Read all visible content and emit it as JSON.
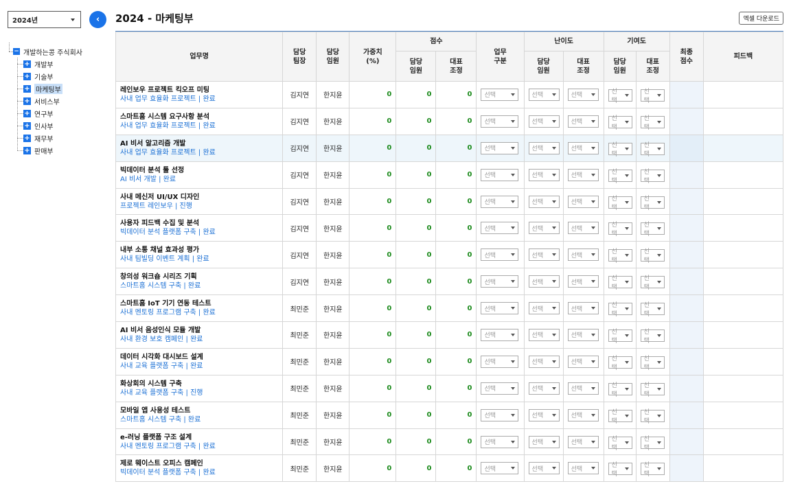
{
  "sidebar": {
    "year": "2024년",
    "collapse_icon": "chevron-left-icon",
    "tree": {
      "root": "개발하는콩 주식회사",
      "children": [
        "개발부",
        "기술부",
        "마케팅부",
        "서비스부",
        "연구부",
        "인사부",
        "재무부",
        "판매부"
      ],
      "selected": "마케팅부"
    }
  },
  "header": {
    "title": "2024 - 마케팅부",
    "excel_button": "엑셀 다운로드"
  },
  "table": {
    "columns": {
      "task": "업무명",
      "team_lead": "담당\n팀장",
      "exec": "담당\n임원",
      "weight": "가중치\n(%)",
      "score": "점수",
      "score_exec": "담당\n임원",
      "score_rep": "대표\n조정",
      "work_type": "업무\n구분",
      "difficulty": "난이도",
      "diff_exec": "담당\n임원",
      "diff_rep": "대표\n조정",
      "contribution": "기여도",
      "contrib_exec": "담당\n임원",
      "contrib_rep": "대표\n조정",
      "final_score": "최종\n점수",
      "feedback": "피드백"
    },
    "select_placeholder": "선택",
    "rows": [
      {
        "name": "레인보우 프로젝트 킥오프 미팅",
        "sub": "사내 업무 효율화 프로젝트 | 완료",
        "lead": "김지연",
        "exec": "한지윤",
        "weight": "0",
        "score_exec": "0",
        "score_rep": "0"
      },
      {
        "name": "스마트홈 시스템 요구사항 분석",
        "sub": "사내 업무 효율화 프로젝트 | 완료",
        "lead": "김지연",
        "exec": "한지윤",
        "weight": "0",
        "score_exec": "0",
        "score_rep": "0"
      },
      {
        "name": "AI 비서 알고리즘 개발",
        "sub": "사내 업무 효율화 프로젝트 | 완료",
        "lead": "김지연",
        "exec": "한지윤",
        "weight": "0",
        "score_exec": "0",
        "score_rep": "0"
      },
      {
        "name": "빅데이터 분석 툴 선정",
        "sub": "AI 비서 개발 | 완료",
        "lead": "김지연",
        "exec": "한지윤",
        "weight": "0",
        "score_exec": "0",
        "score_rep": "0"
      },
      {
        "name": "사내 메신저 UI/UX 디자인",
        "sub": "프로젝트 레인보우 | 진행",
        "lead": "김지연",
        "exec": "한지윤",
        "weight": "0",
        "score_exec": "0",
        "score_rep": "0"
      },
      {
        "name": "사용자 피드백 수집 및 분석",
        "sub": "빅데이터 분석 플랫폼 구축 | 완료",
        "lead": "김지연",
        "exec": "한지윤",
        "weight": "0",
        "score_exec": "0",
        "score_rep": "0"
      },
      {
        "name": "내부 소통 채널 효과성 평가",
        "sub": "사내 팀빌딩 이벤트 계획 | 완료",
        "lead": "김지연",
        "exec": "한지윤",
        "weight": "0",
        "score_exec": "0",
        "score_rep": "0"
      },
      {
        "name": "창의성 워크숍 시리즈 기획",
        "sub": "스마트홈 시스템 구축 | 완료",
        "lead": "김지연",
        "exec": "한지윤",
        "weight": "0",
        "score_exec": "0",
        "score_rep": "0"
      },
      {
        "name": "스마트홈 IoT 기기 연동 테스트",
        "sub": "사내 멘토링 프로그램 구축 | 완료",
        "lead": "최민준",
        "exec": "한지윤",
        "weight": "0",
        "score_exec": "0",
        "score_rep": "0"
      },
      {
        "name": "AI 비서 음성인식 모듈 개발",
        "sub": "사내 환경 보호 캠페인 | 완료",
        "lead": "최민준",
        "exec": "한지윤",
        "weight": "0",
        "score_exec": "0",
        "score_rep": "0"
      },
      {
        "name": "데이터 시각화 대시보드 설계",
        "sub": "사내 교육 플랫폼 구축 | 완료",
        "lead": "최민준",
        "exec": "한지윤",
        "weight": "0",
        "score_exec": "0",
        "score_rep": "0"
      },
      {
        "name": "화상회의 시스템 구축",
        "sub": "사내 교육 플랫폼 구축 | 진행",
        "lead": "최민준",
        "exec": "한지윤",
        "weight": "0",
        "score_exec": "0",
        "score_rep": "0"
      },
      {
        "name": "모바일 앱 사용성 테스트",
        "sub": "스마트홈 시스템 구축 | 완료",
        "lead": "최민준",
        "exec": "한지윤",
        "weight": "0",
        "score_exec": "0",
        "score_rep": "0"
      },
      {
        "name": "e-러닝 플랫폼 구조 설계",
        "sub": "사내 멘토링 프로그램 구축 | 완료",
        "lead": "최민준",
        "exec": "한지윤",
        "weight": "0",
        "score_exec": "0",
        "score_rep": "0"
      },
      {
        "name": "제로 웨이스트 오피스 캠페인",
        "sub": "빅데이터 분석 플랫폼 구축 | 완료",
        "lead": "최민준",
        "exec": "한지윤",
        "weight": "0",
        "score_exec": "0",
        "score_rep": "0"
      }
    ],
    "highlighted_row": 2
  },
  "colors": {
    "accent": "#1a73e8",
    "link": "#1a6fd4",
    "score": "#1b8a1b"
  }
}
